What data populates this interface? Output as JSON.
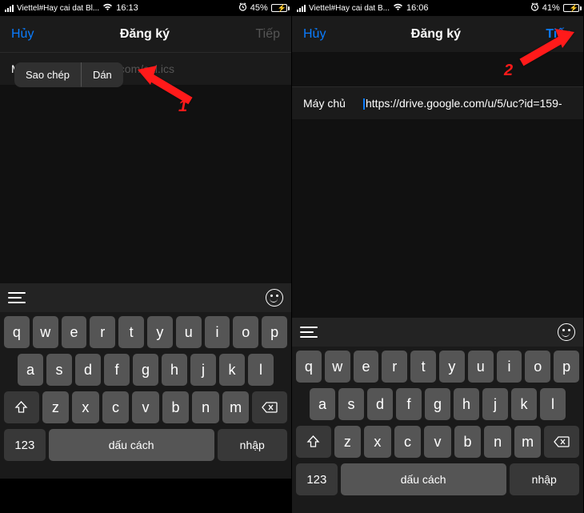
{
  "left": {
    "status": {
      "carrier": "Viettel#Hay cai dat Bl...",
      "time": "16:13",
      "battery_pct": "45%",
      "battery_fill_pct": 45
    },
    "nav": {
      "cancel": "Hủy",
      "title": "Đăng ký",
      "next": "Tiếp",
      "next_enabled": false
    },
    "context_menu": {
      "copy": "Sao chép",
      "paste": "Dán"
    },
    "field": {
      "label": "Máy chủ",
      "placeholder": "example.com/cal.ics",
      "value": ""
    },
    "annotation": "1"
  },
  "right": {
    "status": {
      "carrier": "Viettel#Hay cai dat B...",
      "time": "16:06",
      "battery_pct": "41%",
      "battery_fill_pct": 41
    },
    "nav": {
      "cancel": "Hủy",
      "title": "Đăng ký",
      "next": "Tiếp",
      "next_enabled": true
    },
    "field": {
      "label": "Máy chủ",
      "placeholder": "",
      "value": "https://drive.google.com/u/5/uc?id=159-"
    },
    "annotation": "2"
  },
  "keyboard": {
    "row1": [
      "q",
      "w",
      "e",
      "r",
      "t",
      "y",
      "u",
      "i",
      "o",
      "p"
    ],
    "row2": [
      "a",
      "s",
      "d",
      "f",
      "g",
      "h",
      "j",
      "k",
      "l"
    ],
    "row3": [
      "z",
      "x",
      "c",
      "v",
      "b",
      "n",
      "m"
    ],
    "shift": "⇧",
    "backspace": "⌫",
    "numbers": "123",
    "space": "dấu cách",
    "return": "nhập"
  }
}
